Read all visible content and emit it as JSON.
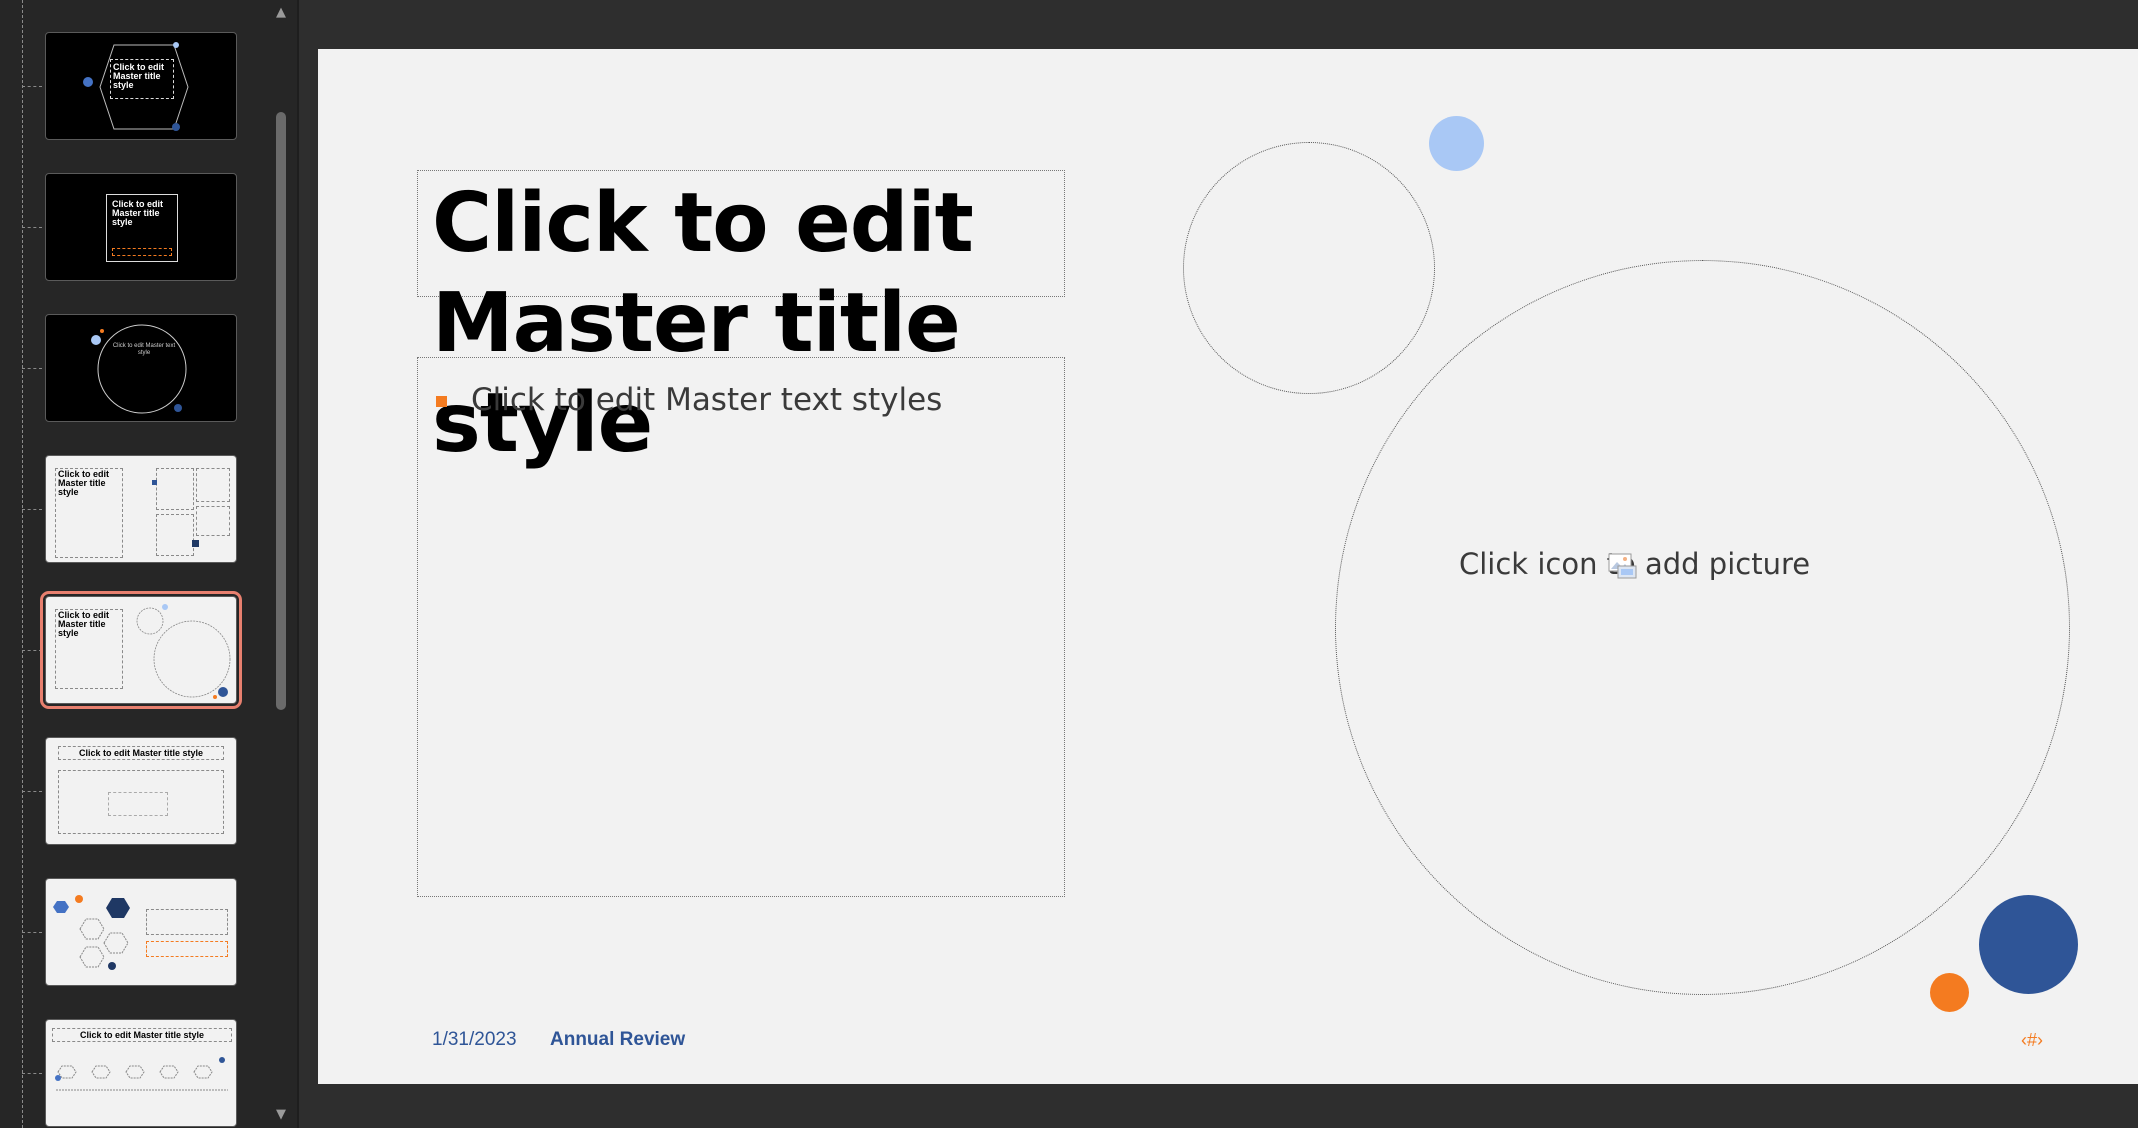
{
  "thumbnails": [
    {
      "title": "Click to edit Master title style",
      "theme": "dark"
    },
    {
      "title": "Click to edit Master title style",
      "theme": "dark"
    },
    {
      "title": "Click to edit Master text style",
      "theme": "dark"
    },
    {
      "title": "Click to edit Master title style",
      "theme": "light"
    },
    {
      "title": "Click to edit Master title style",
      "theme": "light",
      "selected": true
    },
    {
      "title": "Click to edit Master title style",
      "theme": "light"
    },
    {
      "title": "",
      "theme": "light"
    },
    {
      "title": "Click to edit Master title style",
      "theme": "light"
    }
  ],
  "scrollbar": {
    "up_icon": "▲",
    "down_icon": "▼"
  },
  "slide": {
    "title": "Click to edit Master title style",
    "body": "Click to edit Master text styles",
    "picture_placeholder": "Click icon to add picture",
    "footer_date": "1/31/2023",
    "footer_text": "Annual Review",
    "slide_number": "‹#›"
  },
  "colors": {
    "accent_orange": "#f47b20",
    "accent_blue": "#2f5597",
    "light_blue": "#a9c8f5",
    "selection": "#e8806f"
  }
}
